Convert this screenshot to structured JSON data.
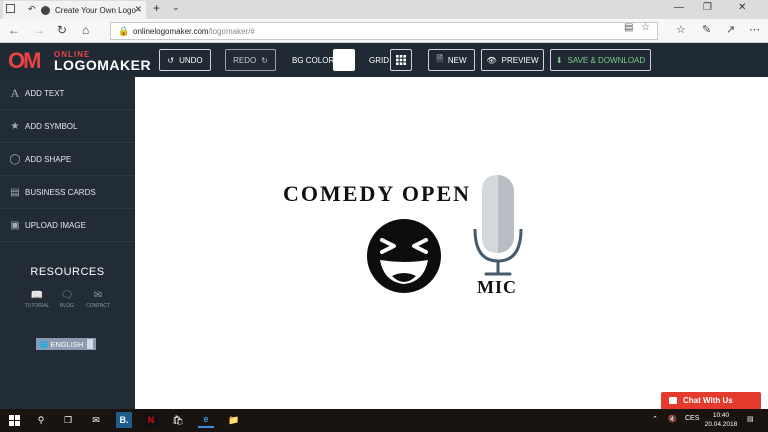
{
  "browser": {
    "tab_title": "Create Your Own Logo -",
    "url_domain": "onlinelogomaker.com",
    "url_path": "/logomaker/#"
  },
  "logo": {
    "mark": "OM",
    "top_word": "ONLINE",
    "main_word": "LOGOMAKER"
  },
  "toolbar": {
    "undo": "UNDO",
    "redo": "REDO",
    "bg_color_label": "BG COLOR",
    "bg_color": "#ffffff",
    "grid_label": "GRID",
    "new": "NEW",
    "preview": "PREVIEW",
    "save": "SAVE & DOWNLOAD"
  },
  "sidebar": {
    "items": [
      {
        "label": "ADD TEXT",
        "icon": "text-icon"
      },
      {
        "label": "ADD SYMBOL",
        "icon": "star-icon"
      },
      {
        "label": "ADD SHAPE",
        "icon": "circle-icon"
      },
      {
        "label": "BUSINESS CARDS",
        "icon": "card-icon"
      },
      {
        "label": "UPLOAD IMAGE",
        "icon": "image-icon"
      }
    ],
    "resources_title": "RESOURCES",
    "resources": [
      {
        "label": "TUTORIAL",
        "icon": "book-icon"
      },
      {
        "label": "BLOG",
        "icon": "speech-bubble-icon"
      },
      {
        "label": "CONTACT",
        "icon": "envelope-icon"
      }
    ],
    "language": "ENGLISH"
  },
  "canvas": {
    "title_text": "COMEDY OPEN",
    "sub_text": "MIC"
  },
  "chat": {
    "label": "Chat With Us"
  },
  "taskbar": {
    "language": "CES",
    "time": "10:40",
    "date": "20.04.2018"
  },
  "colors": {
    "accent_red": "#e84444",
    "header_bg": "#1f2a34",
    "save_green": "#7bd08a",
    "chat_red": "#e53a2e"
  }
}
